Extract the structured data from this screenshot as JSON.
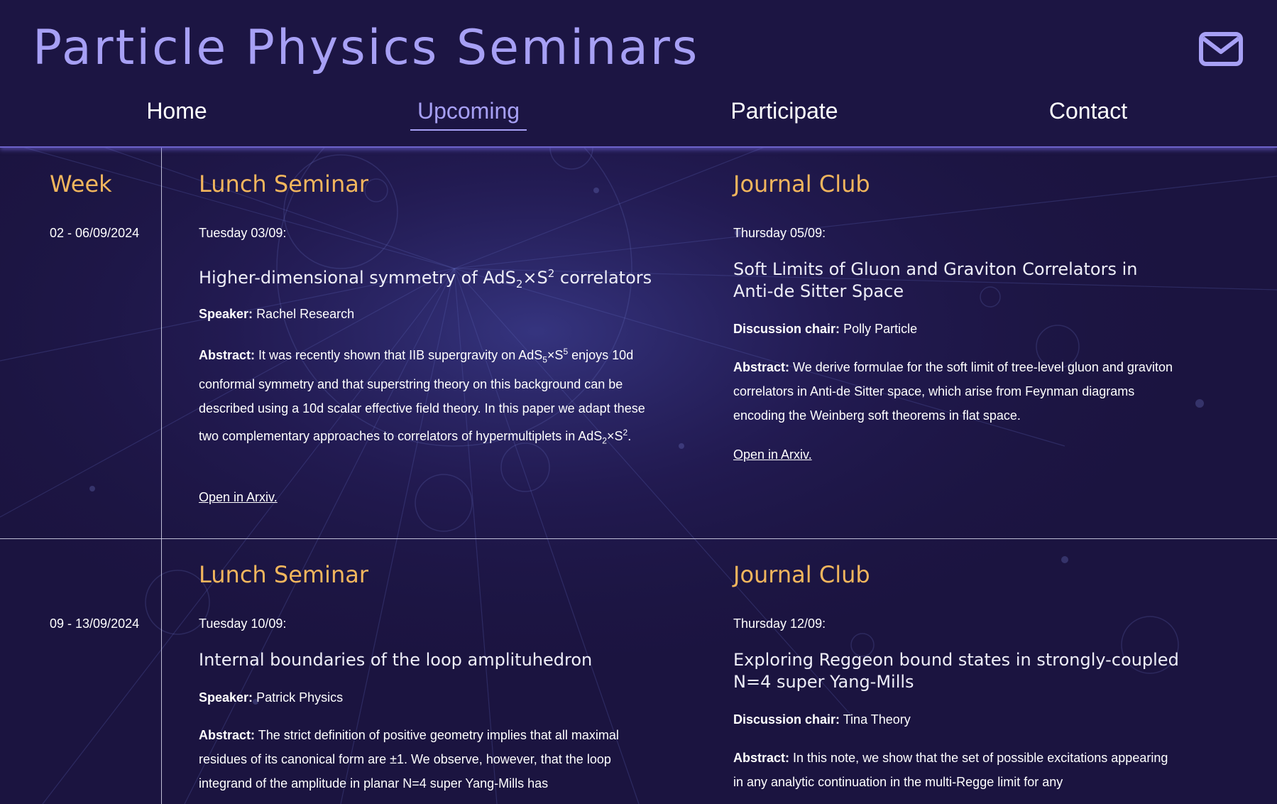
{
  "header": {
    "title": "Particle Physics Seminars",
    "contact_icon": "envelope-icon"
  },
  "nav": {
    "items": [
      {
        "label": "Home",
        "active": false
      },
      {
        "label": "Upcoming",
        "active": true
      },
      {
        "label": "Participate",
        "active": false
      },
      {
        "label": "Contact",
        "active": false
      }
    ]
  },
  "colors": {
    "background": "#1b1440",
    "accent": "#a7a0f5",
    "heading": "#f2b65d",
    "text": "#ffffff"
  },
  "schedule": {
    "week_heading": "Week",
    "weeks": [
      {
        "range": "02 - 06/09/2024",
        "lunch": {
          "heading": "Lunch Seminar",
          "date": "Tuesday 03/09:",
          "title_parts": [
            "Higher-dimensional symmetry of AdS",
            "2",
            "×S",
            "2",
            " correlators"
          ],
          "speaker_label": "Speaker:",
          "speaker": "Rachel Research",
          "abstract_label": "Abstract:",
          "abstract_parts": [
            "It was recently shown that IIB supergravity on AdS",
            "5",
            "×S",
            "5",
            " enjoys 10d conformal symmetry and that superstring theory on this background can be described using a 10d scalar effective field theory. In this paper we adapt these two complementary approaches to correlators of hypermultiplets in AdS",
            "2",
            "×S",
            "2",
            "."
          ],
          "link": "Open in Arxiv."
        },
        "journal": {
          "heading": "Journal Club",
          "date": "Thursday 05/09:",
          "title": "Soft Limits of Gluon and Graviton Correlators in Anti-de Sitter Space",
          "chair_label": "Discussion chair:",
          "chair": "Polly Particle",
          "abstract_label": "Abstract:",
          "abstract": "We derive formulae for the soft limit of tree-level gluon and graviton correlators in Anti-de Sitter space, which arise from Feynman diagrams encoding the Weinberg soft theorems in flat space.",
          "link": "Open in Arxiv."
        }
      },
      {
        "range": "09 - 13/09/2024",
        "lunch": {
          "heading": "Lunch Seminar",
          "date": "Tuesday 10/09:",
          "title": "Internal boundaries of the loop amplituhedron",
          "speaker_label": "Speaker:",
          "speaker": "Patrick Physics",
          "abstract_label": "Abstract:",
          "abstract": "The strict definition of positive geometry implies that all maximal residues of its canonical form are ±1. We observe, however, that the loop integrand of the amplitude in planar N=4 super Yang-Mills has"
        },
        "journal": {
          "heading": "Journal Club",
          "date": "Thursday 12/09:",
          "title": "Exploring Reggeon bound states in strongly-coupled N=4 super Yang-Mills",
          "chair_label": "Discussion chair:",
          "chair": "Tina Theory",
          "abstract_label": "Abstract:",
          "abstract": "In this note, we show that the set of possible excitations appearing in any analytic continuation in the multi-Regge limit for any"
        }
      }
    ]
  }
}
